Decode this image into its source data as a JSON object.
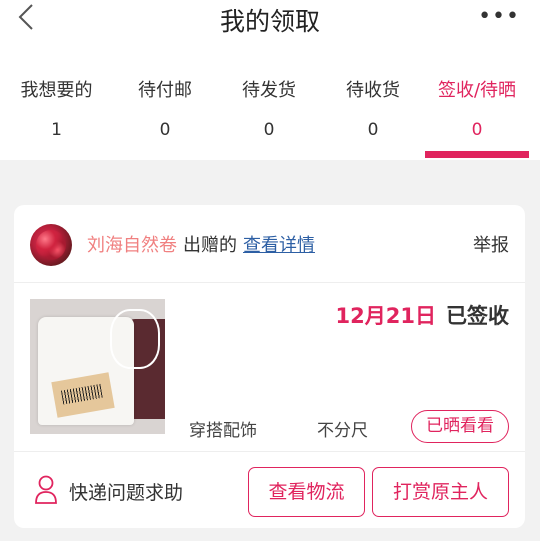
{
  "header": {
    "title": "我的领取",
    "more": "•••"
  },
  "tabs": [
    {
      "label": "我想要的",
      "count": "1"
    },
    {
      "label": "待付邮",
      "count": "0"
    },
    {
      "label": "待发货",
      "count": "0"
    },
    {
      "label": "待收货",
      "count": "0"
    },
    {
      "label": "签收/待晒",
      "count": "0",
      "active": true
    }
  ],
  "colors": {
    "accent": "#e0245e",
    "giver_name": "#f08080",
    "link": "#2d5fa4",
    "background": "#f2f2f2"
  },
  "order": {
    "giver_name": "刘海自然卷",
    "giver_verb": "出赠的",
    "detail_link": "查看详情",
    "report": "举报",
    "date": "12月21日",
    "state": "已签收",
    "category": "穿搭配饰",
    "size": "不分尺",
    "showoff_button": "已晒看看",
    "help_text": "快递问题求助",
    "logistics_button": "查看物流",
    "tip_button": "打赏原主人"
  }
}
